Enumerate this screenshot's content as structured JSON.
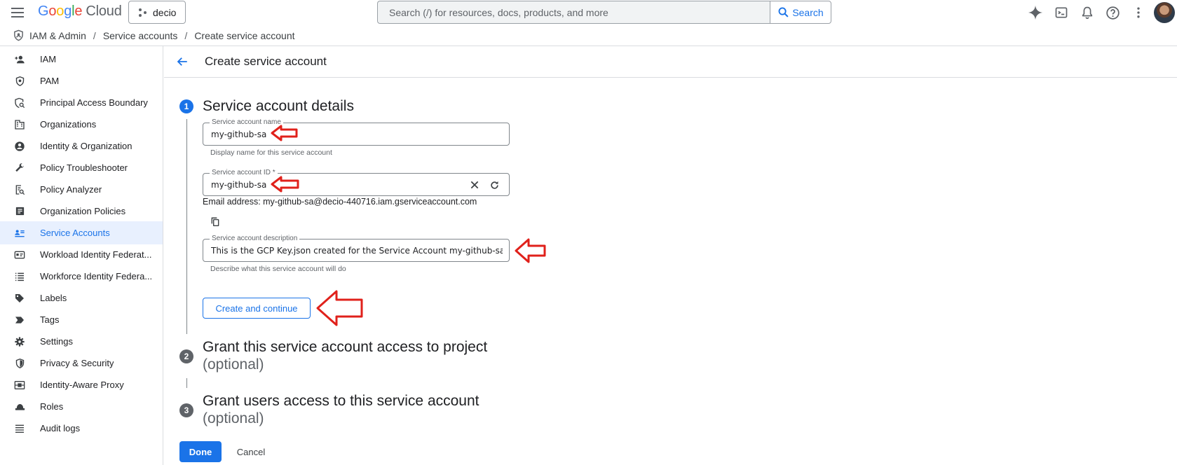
{
  "brand": {
    "google": [
      "G",
      "o",
      "o",
      "g",
      "l",
      "e"
    ],
    "google_colors": [
      "#4285f4",
      "#ea4335",
      "#fbbc04",
      "#4285f4",
      "#34a853",
      "#ea4335"
    ],
    "cloud": "Cloud"
  },
  "project": {
    "name": "decio"
  },
  "search": {
    "placeholder": "Search (/) for resources, docs, products, and more",
    "button_label": "Search"
  },
  "top_icons": [
    "gemini-icon",
    "cloud-shell-icon",
    "notifications-icon",
    "help-icon",
    "more-vert-icon"
  ],
  "breadcrumb": {
    "items": [
      "IAM & Admin",
      "Service accounts",
      "Create service account"
    ],
    "separator": "/"
  },
  "sidebar": {
    "items": [
      {
        "label": "IAM",
        "icon": "person-add-icon"
      },
      {
        "label": "PAM",
        "icon": "shield-icon"
      },
      {
        "label": "Principal Access Boundary",
        "icon": "policy-icon"
      },
      {
        "label": "Organizations",
        "icon": "domain-icon"
      },
      {
        "label": "Identity & Organization",
        "icon": "account-circle-icon"
      },
      {
        "label": "Policy Troubleshooter",
        "icon": "wrench-icon"
      },
      {
        "label": "Policy Analyzer",
        "icon": "analyzer-icon"
      },
      {
        "label": "Organization Policies",
        "icon": "article-icon"
      },
      {
        "label": "Service Accounts",
        "icon": "service-account-icon",
        "active": true
      },
      {
        "label": "Workload Identity Federat...",
        "icon": "badge-icon"
      },
      {
        "label": "Workforce Identity Federa...",
        "icon": "list-icon"
      },
      {
        "label": "Labels",
        "icon": "label-icon"
      },
      {
        "label": "Tags",
        "icon": "tag-icon"
      },
      {
        "label": "Settings",
        "icon": "gear-icon"
      },
      {
        "label": "Privacy & Security",
        "icon": "security-icon"
      },
      {
        "label": "Identity-Aware Proxy",
        "icon": "proxy-icon"
      },
      {
        "label": "Roles",
        "icon": "roles-icon"
      },
      {
        "label": "Audit logs",
        "icon": "logs-icon"
      }
    ]
  },
  "page": {
    "title": "Create service account"
  },
  "steps": [
    {
      "number": "1",
      "title": "Service account details",
      "optional": ""
    },
    {
      "number": "2",
      "title": "Grant this service account access to project",
      "optional": "(optional)"
    },
    {
      "number": "3",
      "title": "Grant users access to this service account",
      "optional": "(optional)"
    }
  ],
  "form": {
    "name": {
      "label": "Service account name",
      "value": "my-github-sa",
      "hint": "Display name for this service account"
    },
    "id": {
      "label": "Service account ID *",
      "value": "my-github-sa"
    },
    "email": "Email address: my-github-sa@decio-440716.iam.gserviceaccount.com",
    "description": {
      "label": "Service account description",
      "value": "This is the GCP Key.json created for the Service Account my-github-sa to",
      "hint": "Describe what this service account will do"
    },
    "create_button": "Create and continue"
  },
  "actions": {
    "done": "Done",
    "cancel": "Cancel"
  },
  "colors": {
    "accent": "#1a73e8",
    "annotation": "#e0211b",
    "active_bg": "#e8f0fe",
    "border": "#dadce0"
  }
}
